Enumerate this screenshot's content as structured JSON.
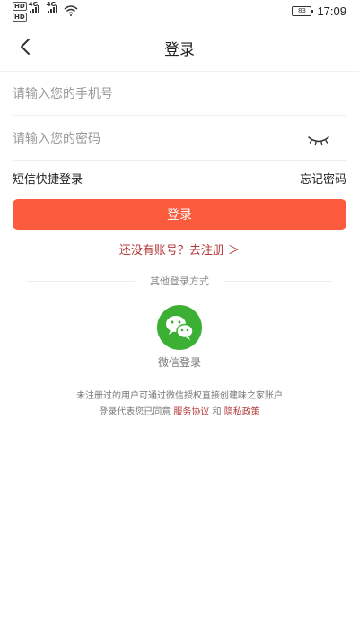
{
  "status_bar": {
    "network_badges": [
      "HD",
      "HD"
    ],
    "signal_labels": [
      "4G",
      "4G"
    ],
    "battery": "83",
    "time": "17:09"
  },
  "nav": {
    "title": "登录",
    "back_icon": "chevron-left-icon"
  },
  "form": {
    "phone_placeholder": "请输入您的手机号",
    "phone_value": "",
    "password_placeholder": "请输入您的密码",
    "password_value": "",
    "eye_icon": "eye-closed-icon",
    "sms_login_label": "短信快捷登录",
    "forgot_password_label": "忘记密码",
    "login_button_label": "登录",
    "register_link_label": "还没有账号？去注册 ＞"
  },
  "other_login": {
    "heading": "其他登录方式",
    "wechat_icon": "wechat-icon",
    "wechat_label": "微信登录"
  },
  "notice": {
    "line1": "未注册过的用户可通过微信授权直接创建味之家账户",
    "line2_prefix": "登录代表您已同意",
    "service_agreement": "服务协议",
    "and": "和",
    "privacy_policy": "隐私政策"
  },
  "colors": {
    "accent": "#fb5a3c",
    "link": "#b43a3a",
    "wechat": "#3cb034"
  }
}
